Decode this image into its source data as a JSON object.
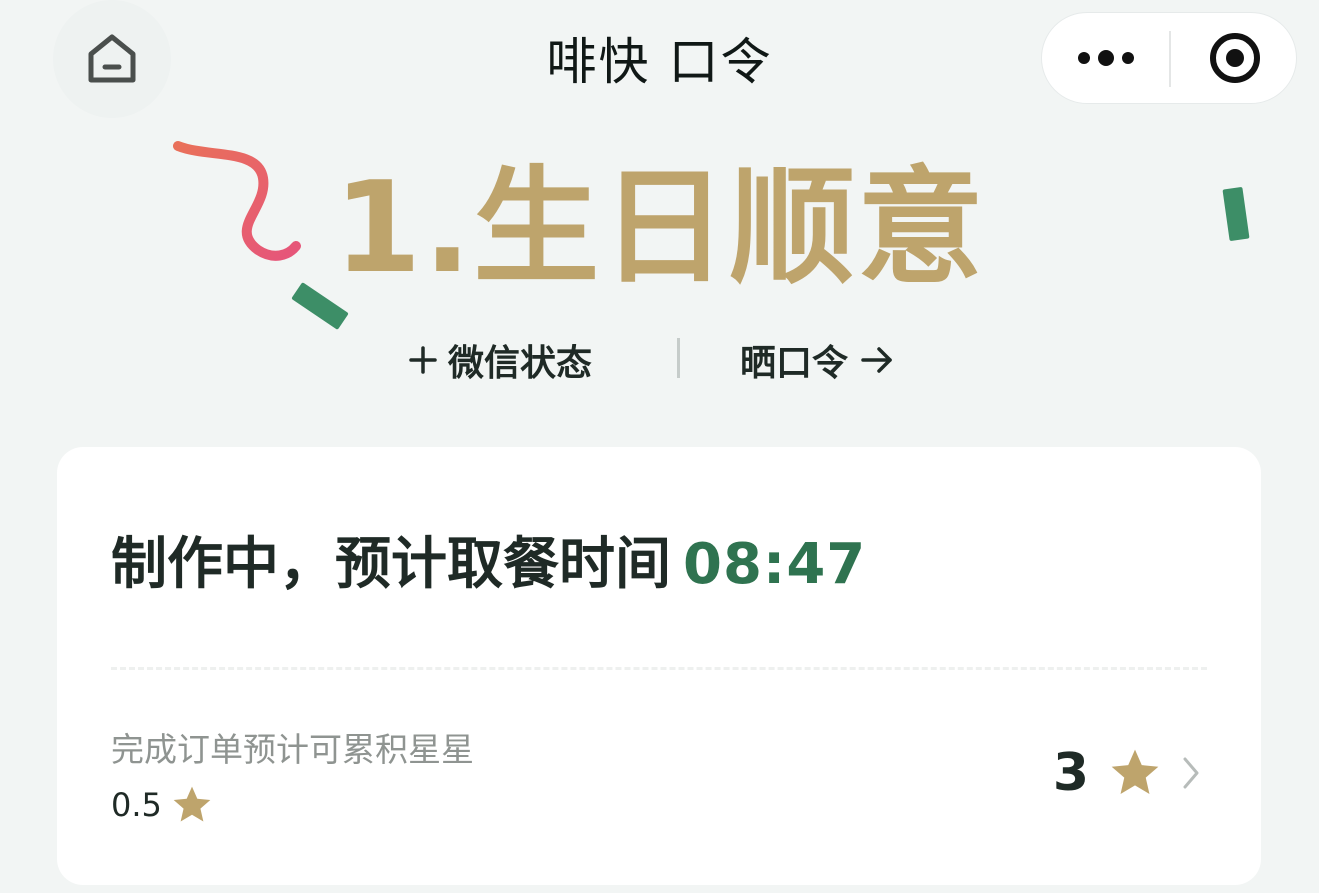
{
  "header": {
    "brand": "啡快",
    "brand_tm": "™",
    "subtitle": "口令",
    "home_icon": "home-icon",
    "more_icon": "more-dots-icon",
    "close_icon": "target-close-icon"
  },
  "hero": {
    "title": "1.生日顺意",
    "add_status": "微信状态",
    "share_code": "晒口令",
    "colors": {
      "title": "#bea46c",
      "ribbon": "#e7646f",
      "confetti": "#3d8e67"
    }
  },
  "order": {
    "status_text": "制作中，预计取餐时间",
    "pickup_time": "08:47",
    "stars_label": "完成订单预计可累积星星",
    "stars_earned": "0.5",
    "stars_total": "3",
    "accent_color": "#2f7350",
    "star_color": "#bea46c"
  }
}
